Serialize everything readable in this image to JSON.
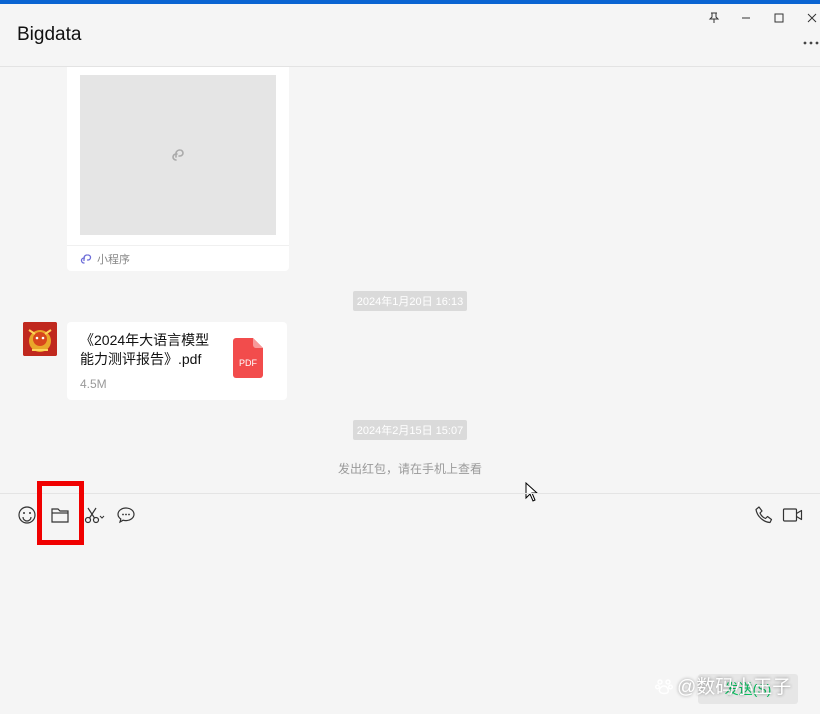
{
  "window": {
    "title": "Bigdata",
    "accent_color": "#0a64d2",
    "controls": [
      "pin-icon",
      "minimize-icon",
      "maximize-icon",
      "close-icon"
    ],
    "more_icon": "more-icon"
  },
  "messages": {
    "mini_program_card": {
      "label": "小程序",
      "icon": "mini-program-icon"
    },
    "timestamp_1": "2024年1月20日 16:13",
    "file_message": {
      "name": "《2024年大语言模型能力测评报告》.pdf",
      "size": "4.5M",
      "icon_label": "PDF",
      "icon_color": "#f24c4c"
    },
    "timestamp_2": "2024年2月15日 15:07",
    "system_note": "发出红包，请在手机上查看"
  },
  "toolbar": {
    "left": [
      "emoji-icon",
      "folder-icon",
      "scissors-icon",
      "chat-bubble-icon"
    ],
    "right": [
      "phone-icon",
      "video-icon"
    ],
    "highlight_color": "#f00000"
  },
  "composer": {
    "value": "",
    "send_label": "发送(S)",
    "send_color": "#07c160"
  },
  "watermark": "@数码小王子"
}
